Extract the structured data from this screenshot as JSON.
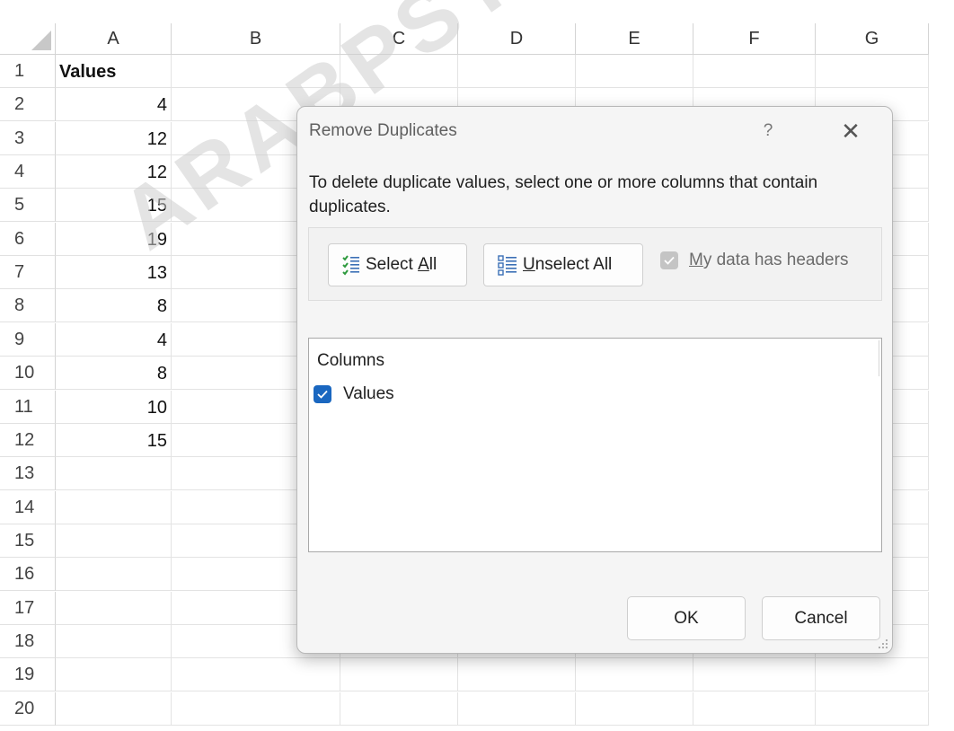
{
  "sheet": {
    "columns": [
      "A",
      "B",
      "C",
      "D",
      "E",
      "F",
      "G"
    ],
    "rows": [
      "1",
      "2",
      "3",
      "4",
      "5",
      "6",
      "7",
      "8",
      "9",
      "10",
      "11",
      "12",
      "13",
      "14",
      "15",
      "16",
      "17",
      "18",
      "19",
      "20"
    ],
    "cells_a": [
      "Values",
      "4",
      "12",
      "12",
      "15",
      "19",
      "13",
      "8",
      "4",
      "8",
      "10",
      "15"
    ],
    "watermark": "ARABPSYCH"
  },
  "dialog": {
    "title": "Remove Duplicates",
    "help_label": "?",
    "close_label": "✕",
    "description": "To delete duplicate values, select one or more columns that contain duplicates.",
    "select_all": {
      "mnemonic_before": "Select ",
      "mnemonic": "A",
      "after": "ll"
    },
    "unselect_all": {
      "mnemonic": "U",
      "after": "nselect All"
    },
    "headers_checkbox": {
      "mnemonic": "M",
      "after": "y data has headers",
      "checked": true,
      "enabled": false
    },
    "columns_header": "Columns",
    "columns": [
      {
        "label": "Values",
        "checked": true
      }
    ],
    "ok_label": "OK",
    "cancel_label": "Cancel"
  },
  "colors": {
    "accent": "#1a67c0",
    "dialog_bg": "#f5f5f5",
    "disabled_check": "#c4c4c4"
  },
  "icons": [
    "select-all-icon",
    "unselect-all-icon",
    "check-icon",
    "help-icon",
    "close-icon",
    "resize-grip-icon"
  ]
}
